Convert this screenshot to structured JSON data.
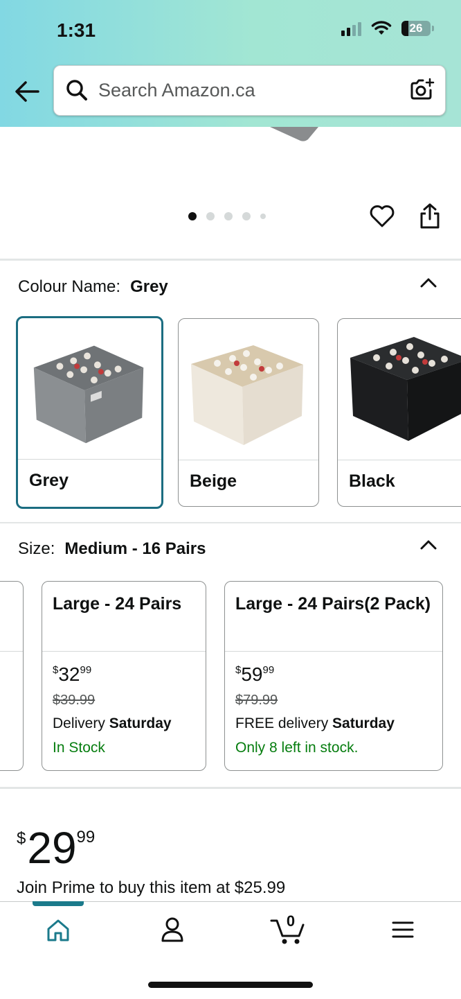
{
  "status_bar": {
    "time": "1:31",
    "battery": "26"
  },
  "search": {
    "placeholder": "Search Amazon.ca"
  },
  "gallery": {
    "dots": 5,
    "active_dot": 0
  },
  "colour": {
    "label": "Colour Name:",
    "selected": "Grey",
    "options": [
      {
        "label": "Grey"
      },
      {
        "label": "Beige"
      },
      {
        "label": "Black"
      }
    ]
  },
  "size": {
    "label": "Size:",
    "selected": "Medium - 16 Pairs",
    "options": [
      {
        "title": "Large - 24 Pairs",
        "price_symbol": "$",
        "price_whole": "32",
        "price_cents": "99",
        "was": "$39.99",
        "delivery_prefix": "Delivery",
        "delivery_day": "Saturday",
        "stock": "In Stock"
      },
      {
        "title": "Large - 24 Pairs(2 Pack)",
        "price_symbol": "$",
        "price_whole": "59",
        "price_cents": "99",
        "was": "$79.99",
        "delivery_prefix": "FREE delivery",
        "delivery_day": "Saturday",
        "stock": "Only 8 left in stock."
      }
    ]
  },
  "price": {
    "symbol": "$",
    "whole": "29",
    "cents": "99"
  },
  "prime": {
    "text": "Join Prime to buy this item at $25.99"
  },
  "nav": {
    "cart_count": "0"
  },
  "colors": {
    "accent": "#1b6d81",
    "in_stock": "#067d0f"
  }
}
